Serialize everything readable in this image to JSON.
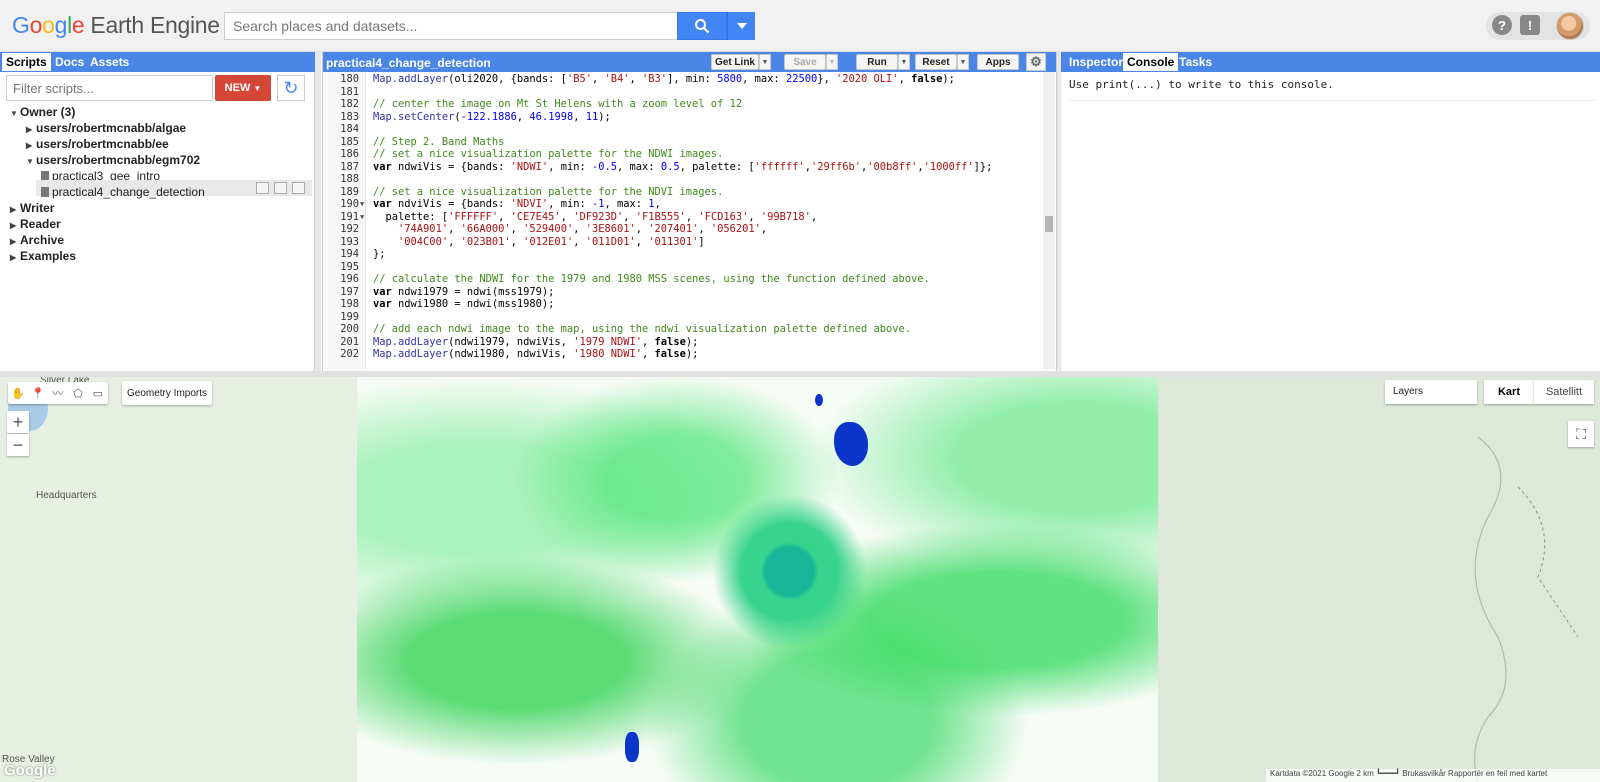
{
  "header": {
    "logo_google": [
      "G",
      "o",
      "o",
      "g",
      "l",
      "e"
    ],
    "logo_product": "Earth Engine",
    "search_placeholder": "Search places and datasets...",
    "help_label": "?",
    "feedback_label": "!"
  },
  "left_panel": {
    "tabs": [
      "Scripts",
      "Docs",
      "Assets"
    ],
    "active_tab": "Scripts",
    "filter_placeholder": "Filter scripts...",
    "new_label": "NEW",
    "tree": {
      "owner": "Owner  (3)",
      "repos": [
        "users/robertmcnabb/algae",
        "users/robertmcnabb/ee",
        "users/robertmcnabb/egm702"
      ],
      "files": [
        "practical3_gee_intro",
        "practical4_change_detection"
      ],
      "sections": [
        "Writer",
        "Reader",
        "Archive",
        "Examples"
      ]
    }
  },
  "editor": {
    "title": "practical4_change_detection",
    "buttons": {
      "get_link": "Get Link",
      "save": "Save",
      "run": "Run",
      "reset": "Reset",
      "apps": "Apps"
    },
    "line_numbers": [
      "180",
      "181",
      "182",
      "183",
      "184",
      "185",
      "186",
      "187",
      "188",
      "189",
      "190",
      "191",
      "192",
      "193",
      "194",
      "195",
      "196",
      "197",
      "198",
      "199",
      "200",
      "201",
      "202"
    ],
    "lines": {
      "l180a": "Map.addLayer",
      "l180b": "(oli2020, {bands: [",
      "l180c": "'B5'",
      "l180d": ", ",
      "l180e": "'B4'",
      "l180f": ", ",
      "l180g": "'B3'",
      "l180h": "], min: ",
      "l180i": "5800",
      "l180j": ", max: ",
      "l180k": "22500",
      "l180l": "}, ",
      "l180m": "'2020 OLI'",
      "l180n": ", ",
      "l180o": "false",
      "l180p": ");",
      "l182": "// center the image on Mt St Helens with a zoom level of 12",
      "l183a": "Map.setCenter",
      "l183b": "(",
      "l183c": "-122.1886",
      "l183d": ", ",
      "l183e": "46.1998",
      "l183f": ", ",
      "l183g": "11",
      "l183h": ");",
      "l185": "// Step 2. Band Maths",
      "l186": "// set a nice visualization palette for the NDWI images.",
      "l187a": "var",
      "l187b": " ndwiVis = {bands: ",
      "l187c": "'NDWI'",
      "l187d": ", min: ",
      "l187e": "-0.5",
      "l187f": ", max: ",
      "l187g": "0.5",
      "l187h": ", palette: [",
      "l187i": "'ffffff'",
      "l187j": ",",
      "l187k": "'29ff6b'",
      "l187l": ",",
      "l187m": "'00b8ff'",
      "l187n": ",",
      "l187o": "'1000ff'",
      "l187p": "]};",
      "l189": "// set a nice visualization palette for the NDVI images.",
      "l190a": "var",
      "l190b": " ndviVis = {bands: ",
      "l190c": "'NDVI'",
      "l190d": ", min: ",
      "l190e": "-1",
      "l190f": ", max: ",
      "l190g": "1",
      "l190h": ",",
      "l191a": "  palette: [",
      "l191b": "'FFFFFF'",
      "l191c": ", ",
      "l191d": "'CE7E45'",
      "l191e": ", ",
      "l191f": "'DF923D'",
      "l191g": ", ",
      "l191h": "'F1B555'",
      "l191i": ", ",
      "l191j": "'FCD163'",
      "l191k": ", ",
      "l191l": "'99B718'",
      "l191m": ",",
      "l192a": "    ",
      "l192b": "'74A901'",
      "l192c": ", ",
      "l192d": "'66A000'",
      "l192e": ", ",
      "l192f": "'529400'",
      "l192g": ", ",
      "l192h": "'3E8601'",
      "l192i": ", ",
      "l192j": "'207401'",
      "l192k": ", ",
      "l192l": "'056201'",
      "l192m": ",",
      "l193a": "    ",
      "l193b": "'004C00'",
      "l193c": ", ",
      "l193d": "'023B01'",
      "l193e": ", ",
      "l193f": "'012E01'",
      "l193g": ", ",
      "l193h": "'011D01'",
      "l193i": ", ",
      "l193j": "'011301'",
      "l193k": "]",
      "l194": "};",
      "l196": "// calculate the NDWI for the 1979 and 1980 MSS scenes, using the function defined above.",
      "l197a": "var",
      "l197b": " ndwi1979 = ndwi(mss1979);",
      "l198a": "var",
      "l198b": " ndwi1980 = ndwi(mss1980);",
      "l200": "// add each ndwi image to the map, using the ndwi visualization palette defined above.",
      "l201a": "Map.addLayer",
      "l201b": "(ndwi1979, ndwiVis, ",
      "l201c": "'1979 NDWI'",
      "l201d": ", ",
      "l201e": "false",
      "l201f": ");",
      "l202a": "Map.addLayer",
      "l202b": "(ndwi1980, ndwiVis, ",
      "l202c": "'1980 NDWI'",
      "l202d": ", ",
      "l202e": "false",
      "l202f": ");"
    }
  },
  "right_panel": {
    "tabs": [
      "Inspector",
      "Console",
      "Tasks"
    ],
    "active_tab": "Console",
    "console_text": "Use print(...) to write to this console."
  },
  "map": {
    "geometry_imports": "Geometry Imports",
    "layers_label": "Layers",
    "map_type_map": "Kart",
    "map_type_satellite": "Satellitt",
    "labels": [
      "Silver Lake",
      "Headquarters",
      "Rose Valley"
    ],
    "watermark": "Google",
    "attribution": "Kartdata ©2021 Google   2 km ┗━━━┛   Brukasvilkår   Rapportér en feil med kartet"
  }
}
